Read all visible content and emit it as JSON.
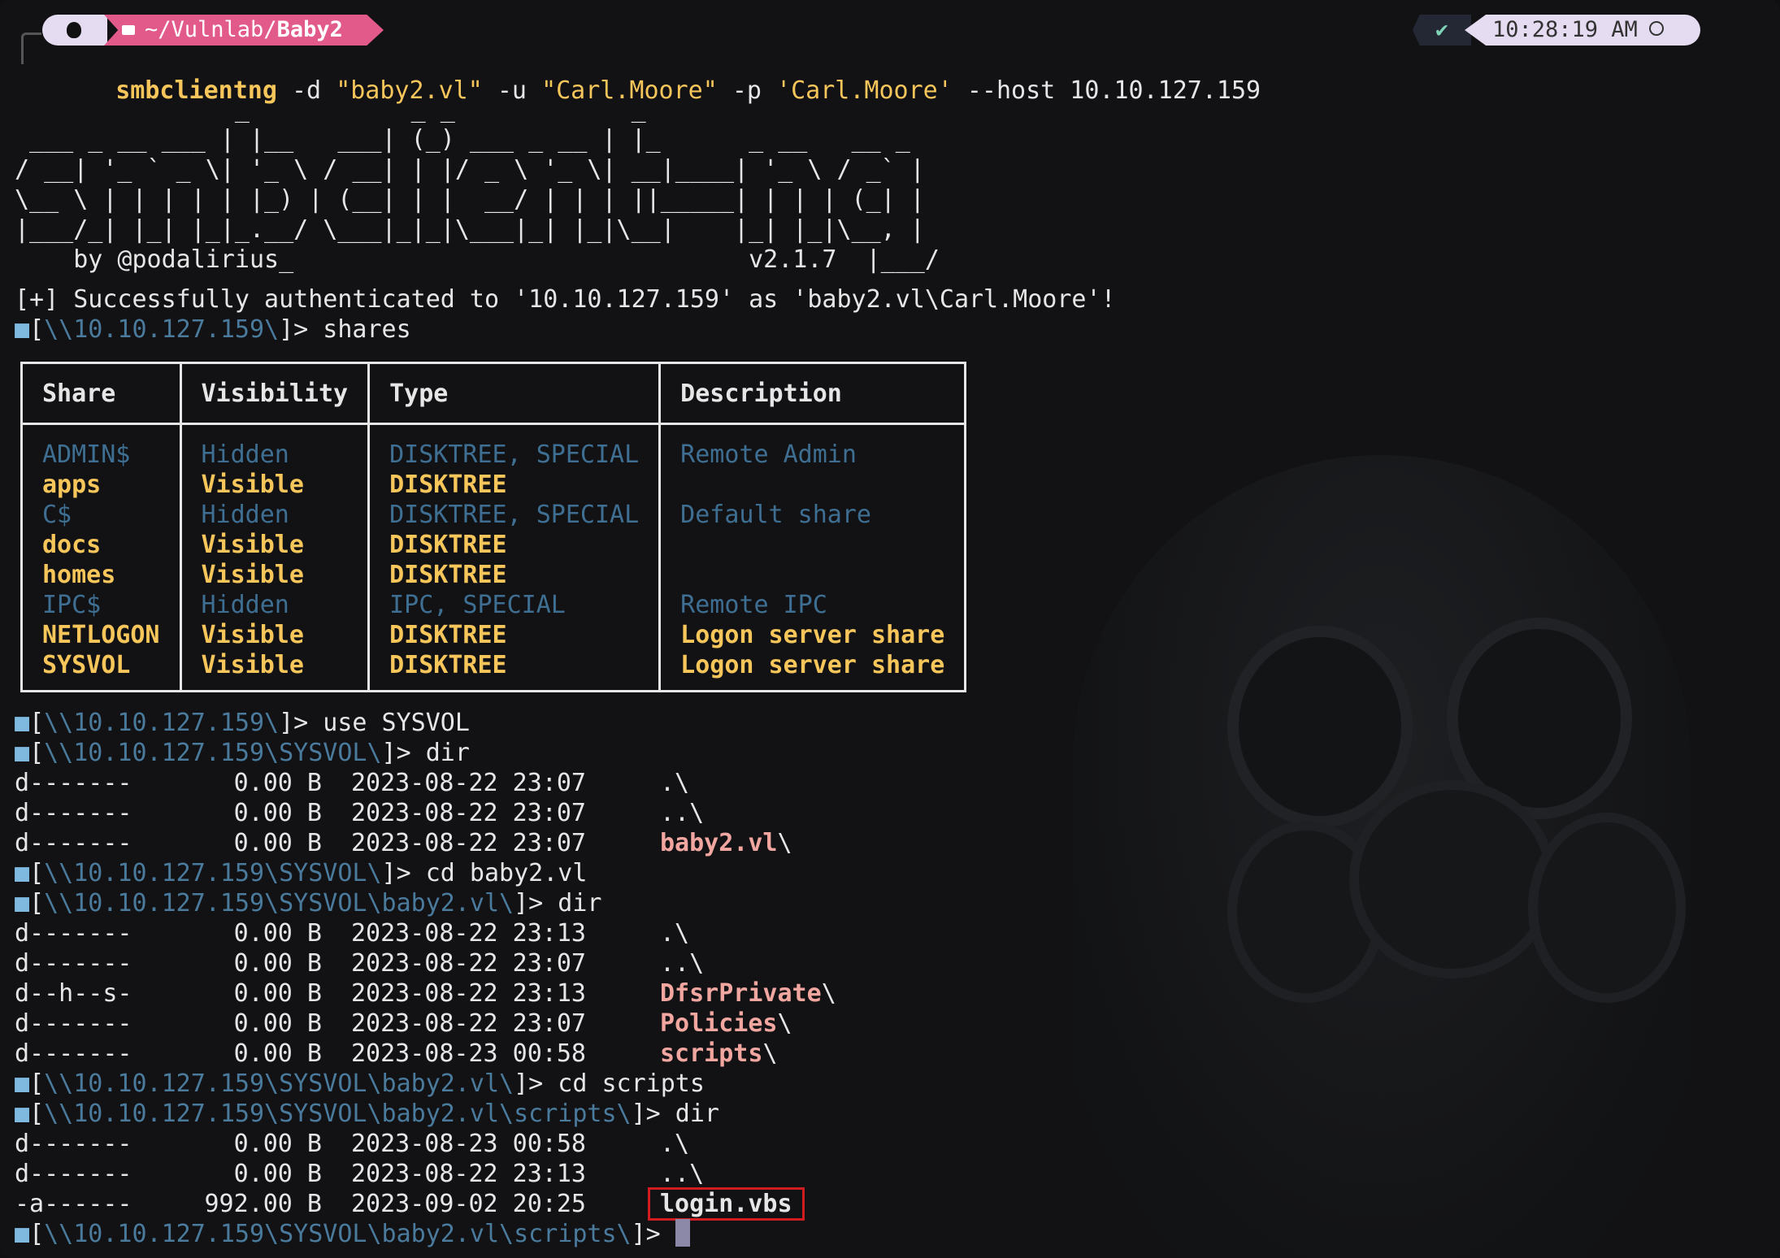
{
  "prompt_bar": {
    "directory_prefix": "~/Vulnlab/",
    "directory_name": "Baby2",
    "status_icon": "✔",
    "time": "10:28:19 AM"
  },
  "command": {
    "binary": "smbclientng",
    "args": [
      {
        "text": " -d ",
        "kind": "arg"
      },
      {
        "text": "\"baby2.vl\"",
        "kind": "str"
      },
      {
        "text": " -u ",
        "kind": "arg"
      },
      {
        "text": "\"Carl.Moore\"",
        "kind": "str"
      },
      {
        "text": " -p ",
        "kind": "arg"
      },
      {
        "text": "'Carl.Moore'",
        "kind": "str"
      },
      {
        "text": " --host 10.10.127.159",
        "kind": "arg"
      }
    ]
  },
  "banner": "               _           _ _            _\n ___ _ __ ___ | |__   ___| (_) ___ _ __ | |_      _ __   __ _\n/ __| '_ ` _ \\| '_ \\ / __| | |/ _ \\ '_ \\| __|____| '_ \\ / _` |\n\\__ \\ | | | | | |_) | (__| | |  __/ | | | ||_____| | | | (_| |\n|___/_| |_| |_|_.__/ \\___|_|_|\\___|_| |_|\\__|    |_| |_|\\__, |\n    by @podalirius_                               v2.1.7  |___/",
  "auth_message": "[+] Successfully authenticated to '10.10.127.159' as 'baby2.vl\\Carl.Moore'!",
  "prompt_square": "■",
  "session": [
    {
      "type": "prompt",
      "path": "\\\\10.10.127.159\\",
      "cmd": " shares"
    },
    {
      "type": "table"
    },
    {
      "type": "prompt",
      "path": "\\\\10.10.127.159\\",
      "cmd": " use SYSVOL"
    },
    {
      "type": "prompt",
      "path": "\\\\10.10.127.159\\SYSVOL\\",
      "cmd": " dir"
    },
    {
      "type": "entry",
      "perm": "d-------",
      "size": "0.00 B",
      "date": "2023-08-22 23:07",
      "name": ".\\",
      "dir": false
    },
    {
      "type": "entry",
      "perm": "d-------",
      "size": "0.00 B",
      "date": "2023-08-22 23:07",
      "name": "..\\",
      "dir": false
    },
    {
      "type": "entry",
      "perm": "d-------",
      "size": "0.00 B",
      "date": "2023-08-22 23:07",
      "name": "baby2.vl",
      "suffix": "\\",
      "dir": true
    },
    {
      "type": "prompt",
      "path": "\\\\10.10.127.159\\SYSVOL\\",
      "cmd": " cd baby2.vl"
    },
    {
      "type": "prompt",
      "path": "\\\\10.10.127.159\\SYSVOL\\baby2.vl\\",
      "cmd": " dir"
    },
    {
      "type": "entry",
      "perm": "d-------",
      "size": "0.00 B",
      "date": "2023-08-22 23:13",
      "name": ".\\",
      "dir": false
    },
    {
      "type": "entry",
      "perm": "d-------",
      "size": "0.00 B",
      "date": "2023-08-22 23:07",
      "name": "..\\",
      "dir": false
    },
    {
      "type": "entry",
      "perm": "d--h--s-",
      "size": "0.00 B",
      "date": "2023-08-22 23:13",
      "name": "DfsrPrivate",
      "suffix": "\\",
      "dir": true
    },
    {
      "type": "entry",
      "perm": "d-------",
      "size": "0.00 B",
      "date": "2023-08-22 23:07",
      "name": "Policies",
      "suffix": "\\",
      "dir": true
    },
    {
      "type": "entry",
      "perm": "d-------",
      "size": "0.00 B",
      "date": "2023-08-23 00:58",
      "name": "scripts",
      "suffix": "\\",
      "dir": true
    },
    {
      "type": "prompt",
      "path": "\\\\10.10.127.159\\SYSVOL\\baby2.vl\\",
      "cmd": " cd scripts"
    },
    {
      "type": "prompt",
      "path": "\\\\10.10.127.159\\SYSVOL\\baby2.vl\\scripts\\",
      "cmd": " dir"
    },
    {
      "type": "entry",
      "perm": "d-------",
      "size": "0.00 B",
      "date": "2023-08-23 00:58",
      "name": ".\\",
      "dir": false
    },
    {
      "type": "entry",
      "perm": "d-------",
      "size": "0.00 B",
      "date": "2023-08-22 23:13",
      "name": "..\\",
      "dir": false
    },
    {
      "type": "entry",
      "perm": "-a------",
      "size": "992.00 B",
      "date": "2023-09-02 20:25",
      "name": "login.vbs",
      "file": true,
      "highlight": true
    },
    {
      "type": "prompt",
      "path": "\\\\10.10.127.159\\SYSVOL\\baby2.vl\\scripts\\",
      "cmd": " ",
      "cursor": true
    }
  ],
  "shares_table": {
    "headers": [
      "Share",
      "Visibility",
      "Type",
      "Description"
    ],
    "rows": [
      {
        "share": "ADMIN$",
        "visibility": "Hidden",
        "type": "DISKTREE, SPECIAL",
        "description": "Remote Admin"
      },
      {
        "share": "apps",
        "visibility": "Visible",
        "type": "DISKTREE",
        "description": ""
      },
      {
        "share": "C$",
        "visibility": "Hidden",
        "type": "DISKTREE, SPECIAL",
        "description": "Default share"
      },
      {
        "share": "docs",
        "visibility": "Visible",
        "type": "DISKTREE",
        "description": ""
      },
      {
        "share": "homes",
        "visibility": "Visible",
        "type": "DISKTREE",
        "description": ""
      },
      {
        "share": "IPC$",
        "visibility": "Hidden",
        "type": "IPC, SPECIAL",
        "description": "Remote IPC"
      },
      {
        "share": "NETLOGON",
        "visibility": "Visible",
        "type": "DISKTREE",
        "description": "Logon server share"
      },
      {
        "share": "SYSVOL",
        "visibility": "Visible",
        "type": "DISKTREE",
        "description": "Logon server share"
      }
    ]
  },
  "colors": {
    "accent_pink": "#e25a8a",
    "visible_yellow": "#f6c65b",
    "hidden_blue": "#4a7a9c",
    "dir_pink": "#f2a6a0",
    "highlight_red": "#d11c22"
  }
}
